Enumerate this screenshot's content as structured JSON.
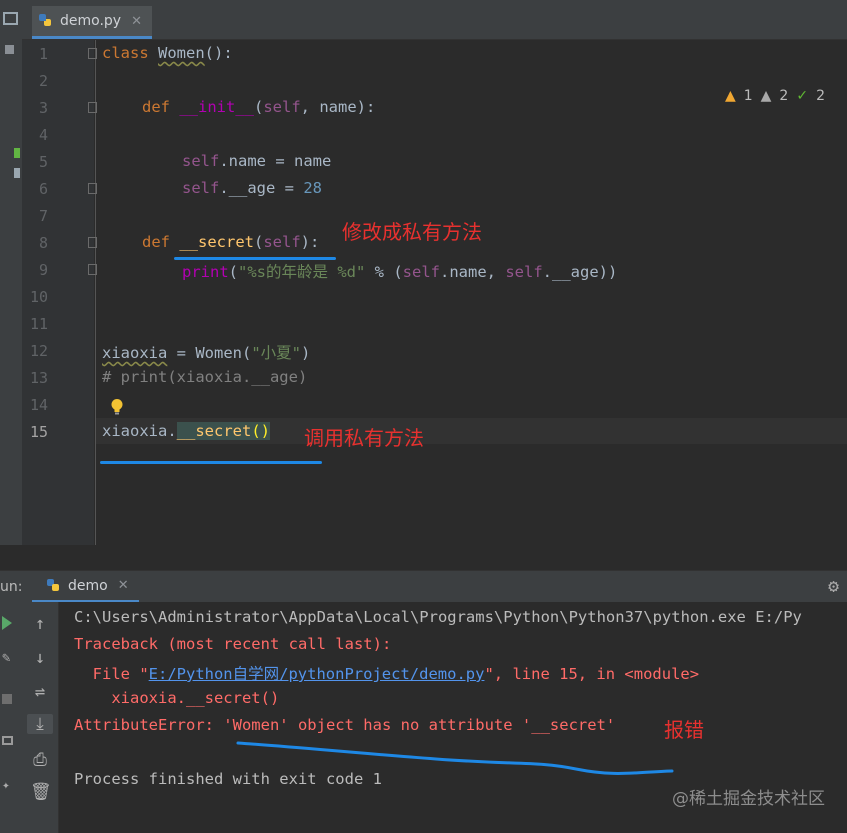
{
  "editor": {
    "file_tab": "demo.py",
    "close_glyph": "✕",
    "inspections": {
      "warnings": "1",
      "weak_warnings": "2",
      "ok": "2"
    },
    "line_numbers": [
      "1",
      "2",
      "3",
      "4",
      "5",
      "6",
      "7",
      "8",
      "9",
      "10",
      "11",
      "12",
      "13",
      "14",
      "15"
    ],
    "lines": {
      "l1_kw": "class ",
      "l1_name": "Women",
      "l1_rest": "():",
      "l3_kw": "def ",
      "l3_fn": "__init__",
      "l3_p1": "(",
      "l3_self": "self",
      "l3_rest": ", name):",
      "l5_self": "self",
      "l5_rest": ".name = name",
      "l6_self": "self",
      "l6_mid": ".__age = ",
      "l6_num": "28",
      "l8_kw": "def ",
      "l8_fn": "__secret",
      "l8_p1": "(",
      "l8_self": "self",
      "l8_rest": "):",
      "l9_fn": "print",
      "l9_p1": "(",
      "l9_str": "\"%s的年龄是 %d\"",
      "l9_mid": " % (",
      "l9_self1": "self",
      "l9_mid2": ".name, ",
      "l9_self2": "self",
      "l9_end": ".__age))",
      "l12_var": "xiaoxia",
      "l12_mid": " = Women(",
      "l12_str": "\"小夏\"",
      "l12_end": ")",
      "l13_cm": "# print(xiaoxia.__age)",
      "l15_var": "xiaoxia.",
      "l15_fn": "__secret",
      "l15_paren": "()"
    },
    "annotations": {
      "private_method": "修改成私有方法",
      "call_private": "调用私有方法"
    }
  },
  "run_panel": {
    "label": "un:",
    "tab": "demo",
    "console": [
      "C:\\Users\\Administrator\\AppData\\Local\\Programs\\Python\\Python37\\python.exe E:/Py",
      "Traceback (most recent call last):",
      "  File \"",
      "E:/Python自学网/pythonProject/demo.py",
      "\", line 15, in <module>",
      "    xiaoxia.__secret()",
      "AttributeError: 'Women' object has no attribute '__secret'",
      "",
      "Process finished with exit code 1"
    ],
    "error_annotation": "报错"
  },
  "watermark": "@稀土掘金技术社区"
}
